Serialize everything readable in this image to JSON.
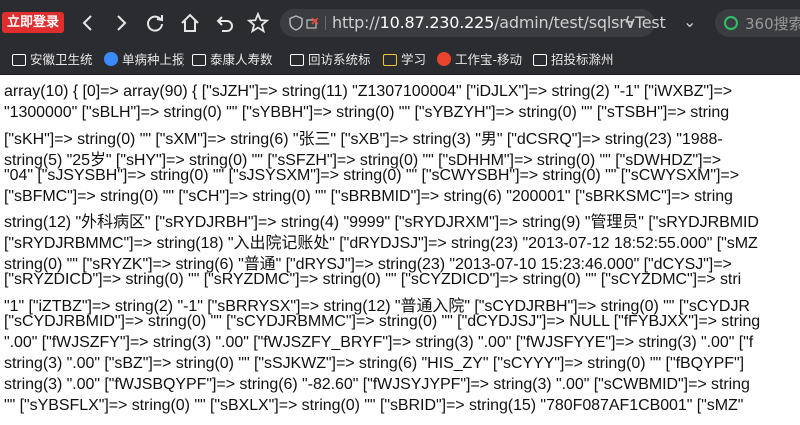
{
  "browser": {
    "login_button": "立即登录",
    "url_prefix": "http://",
    "url_host": "10.87.230.225",
    "url_path": "/admin/test/sqlsrvTest",
    "search_placeholder": "360搜索",
    "colors": {
      "chrome_bg": "#2b2c30",
      "login_bg": "#e02d2d",
      "addr_bg": "#3b3c40"
    }
  },
  "bookmarks": [
    {
      "label": "安徽卫生统",
      "icon": "folder-icon",
      "color": "#ffffff"
    },
    {
      "label": "单病种上报",
      "icon": "globe-icon",
      "color": "#3a8bff"
    },
    {
      "label": "泰康人寿数",
      "icon": "folder-icon",
      "color": "#ffffff"
    },
    {
      "label": "回访系统标",
      "icon": "folder-icon",
      "color": "#ffffff"
    },
    {
      "label": "学习",
      "icon": "folder-icon",
      "color": "#f2c43d"
    },
    {
      "label": "工作宝-移动",
      "icon": "app-icon",
      "color": "#e8432d"
    },
    {
      "label": "招投标滁州",
      "icon": "folder-icon",
      "color": "#ffffff"
    }
  ],
  "content_lines": [
    "array(10) { [0]=> array(90) { [\"sJZH\"]=> string(11) \"Z1307100004\" [\"iDJLX\"]=> string(2) \"-1\" [\"iWXBZ\"]=>",
    "\"1300000\" [\"sBLH\"]=> string(0) \"\" [\"sYBBH\"]=> string(0) \"\" [\"sYBZYH\"]=> string(0) \"\" [\"sTSBH\"]=> string",
    "[\"sKH\"]=> string(0) \"\" [\"sXM\"]=> string(6) \"张三\" [\"sXB\"]=> string(3) \"男\" [\"dCSRQ\"]=> string(23) \"1988-",
    "string(5) \"25岁\" [\"sHY\"]=> string(0) \"\" [\"sSFZH\"]=> string(0) \"\" [\"sDHHM\"]=> string(0) \"\" [\"sDWHDZ\"]=>",
    "\"04\" [\"sJSYSBH\"]=> string(0) \"\" [\"sJSYSXM\"]=> string(0) \"\" [\"sCWYSBH\"]=> string(0) \"\" [\"sCWYSXM\"]=>",
    "[\"sBFMC\"]=> string(0) \"\" [\"sCH\"]=> string(0) \"\" [\"sBRBMID\"]=> string(6) \"200001\" [\"sBRKSMC\"]=> string",
    "string(12) \"外科病区\" [\"sRYDJRBH\"]=> string(4) \"9999\" [\"sRYDJRXM\"]=> string(9) \"管理员\" [\"sRYDJRBMID",
    "[\"sRYDJRBMMC\"]=> string(18) \"入出院记账处\" [\"dRYDJSJ\"]=> string(23) \"2013-07-12 18:52:55.000\" [\"sMZ",
    "string(0) \"\" [\"sRYZK\"]=> string(6) \"普通\" [\"dRYSJ\"]=> string(23) \"2013-07-10 15:23:46.000\" [\"dCYSJ\"]=>",
    "[\"sRYZDICD\"]=> string(0) \"\" [\"sRYZDMC\"]=> string(0) \"\" [\"sCYZDICD\"]=> string(0) \"\" [\"sCYZDMC\"]=> stri",
    "\"1\" [\"iZTBZ\"]=> string(2) \"-1\" [\"sBRRYSX\"]=> string(12) \"普通入院\" [\"sCYDJRBH\"]=> string(0) \"\" [\"sCYDJR",
    "[\"sCYDJRBMID\"]=> string(0) \"\" [\"sCYDJRBMMC\"]=> string(0) \"\" [\"dCYDJSJ\"]=> NULL [\"fFYBJXX\"]=> string",
    "\".00\" [\"fWJSZFY\"]=> string(3) \".00\" [\"fWJSZFY_BRYF\"]=> string(3) \".00\" [\"fWJSFYYE\"]=> string(3) \".00\" [\"f",
    "string(3) \".00\" [\"sBZ\"]=> string(0) \"\" [\"sSJKWZ\"]=> string(6) \"HIS_ZY\" [\"sCYYY\"]=> string(0) \"\" [\"fBQYPF\"]",
    "string(3) \".00\" [\"fWJSBQYPF\"]=> string(6) \"-82.60\" [\"fWJSYJYPF\"]=> string(3) \".00\" [\"sCWBMID\"]=> string",
    "\"\" [\"sYBSFLX\"]=> string(0) \"\" [\"sBXLX\"]=> string(0) \"\" [\"sBRID\"]=> string(15) \"780F087AF1CB001\" [\"sMZ\""
  ]
}
